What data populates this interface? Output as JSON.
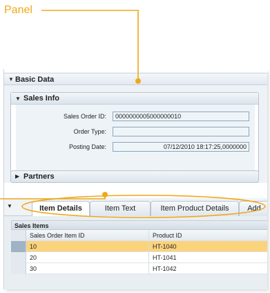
{
  "callout": {
    "label": "Panel",
    "color": "#f0a818"
  },
  "basic_data": {
    "title": "Basic Data",
    "sales_info": {
      "title": "Sales Info",
      "fields": [
        {
          "label": "Sales Order ID:",
          "value": "0000000005000000010"
        },
        {
          "label": "Order Type:",
          "value": ""
        },
        {
          "label": "Posting Date:",
          "value": "07/12/2010 18:17:25,0000000"
        }
      ]
    },
    "partners_title": "Partners"
  },
  "tabs": [
    {
      "label": "Item Details",
      "active": true
    },
    {
      "label": "Item Text",
      "active": false
    },
    {
      "label": "Item Product Details",
      "active": false
    },
    {
      "label": "Add",
      "active": false
    }
  ],
  "sales_items": {
    "title": "Sales Items",
    "columns": [
      "Sales Order Item ID",
      "Product ID"
    ],
    "rows": [
      {
        "item_id": "10",
        "product_id": "HT-1040",
        "selected": true
      },
      {
        "item_id": "20",
        "product_id": "HT-1041",
        "selected": false
      },
      {
        "item_id": "30",
        "product_id": "HT-1042",
        "selected": false
      }
    ]
  },
  "icons": {
    "expanded": "triangle-down-icon",
    "collapsed": "triangle-right-icon"
  }
}
